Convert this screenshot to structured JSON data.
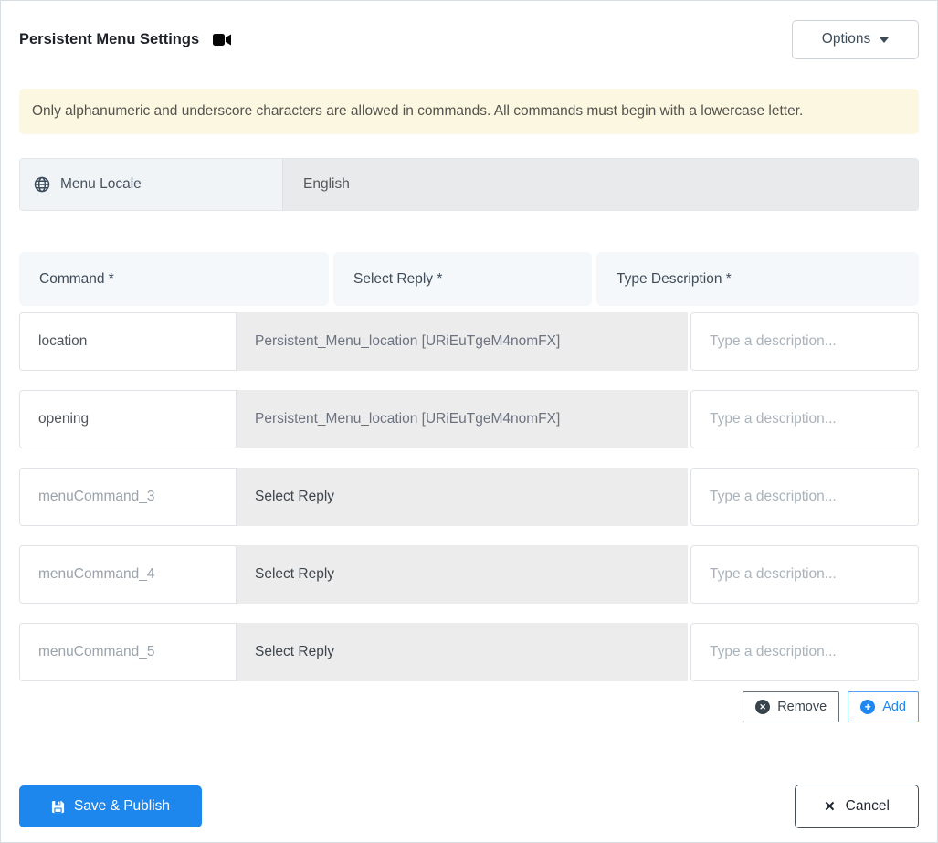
{
  "header": {
    "title": "Persistent Menu Settings",
    "options_label": "Options"
  },
  "alert": {
    "text": "Only alphanumeric and underscore characters are allowed in commands. All commands must begin with a lowercase letter."
  },
  "locale": {
    "label": "Menu Locale",
    "value": "English"
  },
  "table": {
    "headers": [
      {
        "label": "Command *"
      },
      {
        "label": "Select Reply *"
      },
      {
        "label": "Type Description *"
      }
    ],
    "rows": [
      {
        "command": "location",
        "reply": "Persistent_Menu_location [URiEuTgeM4nomFX]",
        "description_placeholder": "Type a description..."
      },
      {
        "command": "opening",
        "reply": "Persistent_Menu_location [URiEuTgeM4nomFX]",
        "description_placeholder": "Type a description..."
      },
      {
        "command_placeholder": "menuCommand_3",
        "reply": "Select Reply",
        "description_placeholder": "Type a description..."
      },
      {
        "command_placeholder": "menuCommand_4",
        "reply": "Select Reply",
        "description_placeholder": "Type a description..."
      },
      {
        "command_placeholder": "menuCommand_5",
        "reply": "Select Reply",
        "description_placeholder": "Type a description..."
      }
    ]
  },
  "actions": {
    "remove_label": "Remove",
    "add_label": "Add"
  },
  "footer": {
    "save_label": "Save & Publish",
    "cancel_label": "Cancel"
  },
  "icons": {
    "title_icon": "video-camera-icon",
    "locale_icon": "globe-icon",
    "options_icon": "caret-down-icon",
    "remove_icon": "x-circle-icon",
    "add_icon": "plus-circle-icon",
    "save_icon": "floppy-disk-icon",
    "cancel_icon": "x-icon"
  },
  "colors": {
    "primary_blue": "#1e87ee",
    "alert_bg": "#fcf7e1",
    "table_header_bg": "#f5f8fa",
    "locale_label_bg": "#f0f4f7",
    "gray_cell_bg": "#ececec"
  }
}
